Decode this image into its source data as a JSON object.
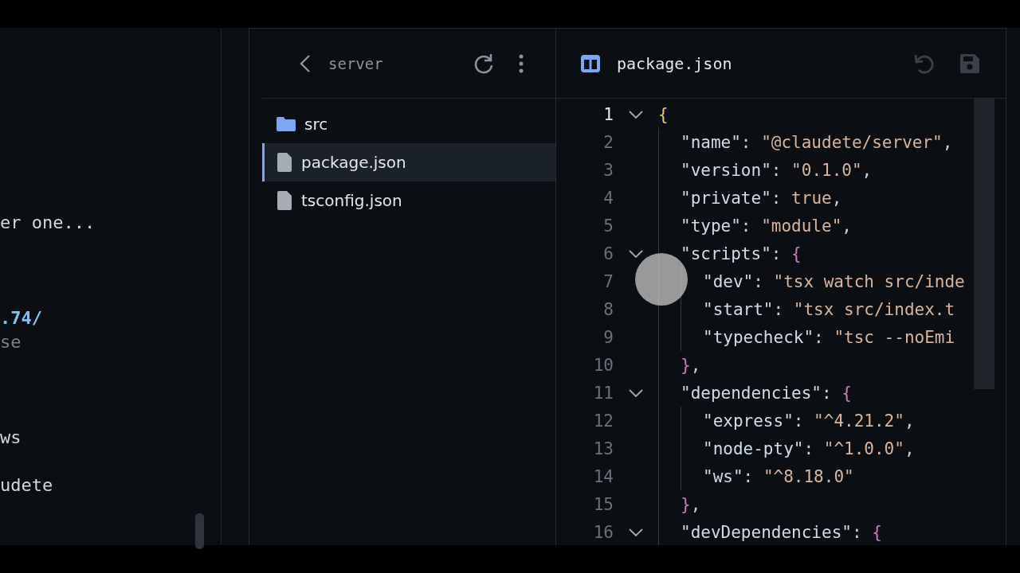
{
  "terminal": {
    "lines": [
      {
        "text": "er one...",
        "kind": "plain"
      },
      {
        "text": ".74/",
        "kind": "link"
      },
      {
        "text": "se",
        "kind": "dim"
      },
      {
        "text": "ws",
        "kind": "plain"
      },
      {
        "text": "udete",
        "kind": "plain"
      }
    ]
  },
  "file_browser": {
    "folder": "server",
    "items": [
      {
        "name": "src",
        "kind": "folder",
        "selected": false
      },
      {
        "name": "package.json",
        "kind": "file",
        "selected": true
      },
      {
        "name": "tsconfig.json",
        "kind": "file",
        "selected": false
      }
    ]
  },
  "editor": {
    "file_name": "package.json",
    "lines": [
      {
        "number": "1",
        "expanded": true,
        "tokens": [
          {
            "kind": "bracket",
            "text": "{"
          }
        ],
        "children": [
          {
            "number": "2",
            "tokens": [
              {
                "kind": "key",
                "text": "\"name\""
              },
              {
                "kind": "punct",
                "text": ": "
              },
              {
                "kind": "string",
                "text": "\"@claudete/server\""
              },
              {
                "kind": "punct",
                "text": ","
              }
            ]
          },
          {
            "number": "3",
            "tokens": [
              {
                "kind": "key",
                "text": "\"version\""
              },
              {
                "kind": "punct",
                "text": ": "
              },
              {
                "kind": "string",
                "text": "\"0.1.0\""
              },
              {
                "kind": "punct",
                "text": ","
              }
            ]
          },
          {
            "number": "4",
            "tokens": [
              {
                "kind": "key",
                "text": "\"private\""
              },
              {
                "kind": "punct",
                "text": ": "
              },
              {
                "kind": "string",
                "text": "true"
              },
              {
                "kind": "punct",
                "text": ","
              }
            ]
          },
          {
            "number": "5",
            "tokens": [
              {
                "kind": "key",
                "text": "\"type\""
              },
              {
                "kind": "punct",
                "text": ": "
              },
              {
                "kind": "string",
                "text": "\"module\""
              },
              {
                "kind": "punct",
                "text": ","
              }
            ]
          },
          {
            "number": "6",
            "expanded": true,
            "tokens": [
              {
                "kind": "key",
                "text": "\"scripts\""
              },
              {
                "kind": "punct",
                "text": ": "
              },
              {
                "kind": "brace",
                "text": "{"
              }
            ],
            "children": [
              {
                "number": "7",
                "tokens": [
                  {
                    "kind": "key",
                    "text": "\"dev\""
                  },
                  {
                    "kind": "punct",
                    "text": ": "
                  },
                  {
                    "kind": "string",
                    "text": "\"tsx watch src/inde"
                  }
                ]
              },
              {
                "number": "8",
                "tokens": [
                  {
                    "kind": "key",
                    "text": "\"start\""
                  },
                  {
                    "kind": "punct",
                    "text": ": "
                  },
                  {
                    "kind": "string",
                    "text": "\"tsx src/index.t"
                  }
                ]
              },
              {
                "number": "9",
                "tokens": [
                  {
                    "kind": "key",
                    "text": "\"typecheck\""
                  },
                  {
                    "kind": "punct",
                    "text": ": "
                  },
                  {
                    "kind": "string",
                    "text": "\"tsc --noEmi"
                  }
                ]
              }
            ]
          },
          {
            "number": "10",
            "tokens": [
              {
                "kind": "brace",
                "text": "}"
              },
              {
                "kind": "punct",
                "text": ","
              }
            ]
          },
          {
            "number": "11",
            "expanded": true,
            "tokens": [
              {
                "kind": "key",
                "text": "\"dependencies\""
              },
              {
                "kind": "punct",
                "text": ": "
              },
              {
                "kind": "brace",
                "text": "{"
              }
            ],
            "children": [
              {
                "number": "12",
                "tokens": [
                  {
                    "kind": "key",
                    "text": "\"express\""
                  },
                  {
                    "kind": "punct",
                    "text": ": "
                  },
                  {
                    "kind": "string",
                    "text": "\"^4.21.2\""
                  },
                  {
                    "kind": "punct",
                    "text": ","
                  }
                ]
              },
              {
                "number": "13",
                "tokens": [
                  {
                    "kind": "key",
                    "text": "\"node-pty\""
                  },
                  {
                    "kind": "punct",
                    "text": ": "
                  },
                  {
                    "kind": "string",
                    "text": "\"^1.0.0\""
                  },
                  {
                    "kind": "punct",
                    "text": ","
                  }
                ]
              },
              {
                "number": "14",
                "tokens": [
                  {
                    "kind": "key",
                    "text": "\"ws\""
                  },
                  {
                    "kind": "punct",
                    "text": ": "
                  },
                  {
                    "kind": "string",
                    "text": "\"^8.18.0\""
                  }
                ]
              }
            ]
          },
          {
            "number": "15",
            "tokens": [
              {
                "kind": "brace",
                "text": "}"
              },
              {
                "kind": "punct",
                "text": ","
              }
            ]
          },
          {
            "number": "16",
            "expanded": true,
            "tokens": [
              {
                "kind": "key",
                "text": "\"devDependencies\""
              },
              {
                "kind": "punct",
                "text": ": "
              },
              {
                "kind": "brace",
                "text": "{"
              }
            ]
          }
        ]
      }
    ]
  }
}
